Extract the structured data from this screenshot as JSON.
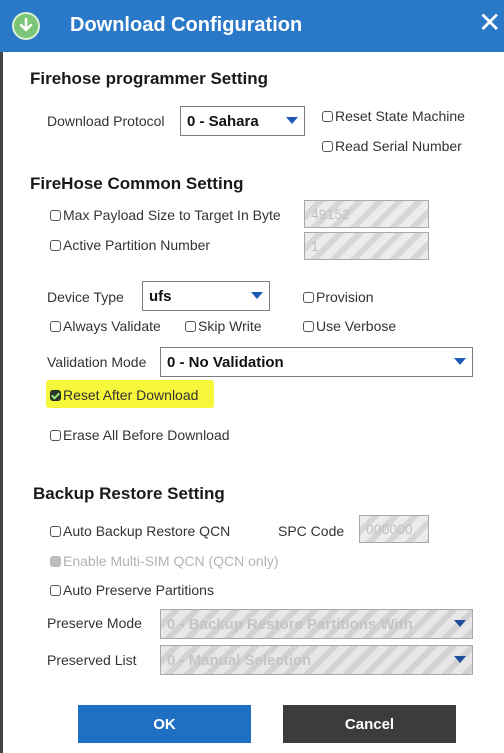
{
  "window": {
    "title": "Download Configuration",
    "close_glyph": "✕",
    "app_icon": "download-icon"
  },
  "firehose_programmer": {
    "title": "Firehose programmer Setting",
    "download_protocol_label": "Download Protocol",
    "download_protocol_value": "0 - Sahara",
    "reset_state_machine": {
      "label": "Reset State Machine",
      "checked": false
    },
    "read_serial_number": {
      "label": "Read Serial Number",
      "checked": false
    }
  },
  "firehose_common": {
    "title": "FireHose Common Setting",
    "max_payload": {
      "label": "Max Payload Size to Target In Byte",
      "checked": false,
      "value": "49152"
    },
    "active_partition": {
      "label": "Active Partition Number",
      "checked": false,
      "value": "1"
    },
    "device_type_label": "Device Type",
    "device_type_value": "ufs",
    "provision": {
      "label": "Provision",
      "checked": false
    },
    "always_validate": {
      "label": "Always Validate",
      "checked": false
    },
    "skip_write": {
      "label": "Skip Write",
      "checked": false
    },
    "use_verbose": {
      "label": "Use Verbose",
      "checked": false
    },
    "validation_mode_label": "Validation Mode",
    "validation_mode_value": "0 - No Validation",
    "reset_after_download": {
      "label": "Reset After Download",
      "checked": true
    },
    "erase_all_before_download": {
      "label": "Erase All Before Download",
      "checked": false
    }
  },
  "backup_restore": {
    "title": "Backup Restore Setting",
    "auto_backup_restore_qcn": {
      "label": "Auto Backup Restore QCN",
      "checked": false
    },
    "spc_code_label": "SPC Code",
    "spc_code_value": "000000",
    "enable_multi_sim_qcn": {
      "label": "Enable Multi-SIM QCN (QCN only)",
      "checked": false
    },
    "auto_preserve_partitions": {
      "label": "Auto Preserve Partitions",
      "checked": false
    },
    "preserve_mode_label": "Preserve Mode",
    "preserve_mode_value": "0 - Backup Restore Partitions With",
    "preserved_list_label": "Preserved List",
    "preserved_list_value": "0 - Manual Selection"
  },
  "buttons": {
    "ok": "OK",
    "cancel": "Cancel"
  },
  "colors": {
    "titlebar": "#2a78c8",
    "ok": "#1f6fc4",
    "cancel": "#3c3c3c",
    "highlight": "#f6f63a"
  }
}
